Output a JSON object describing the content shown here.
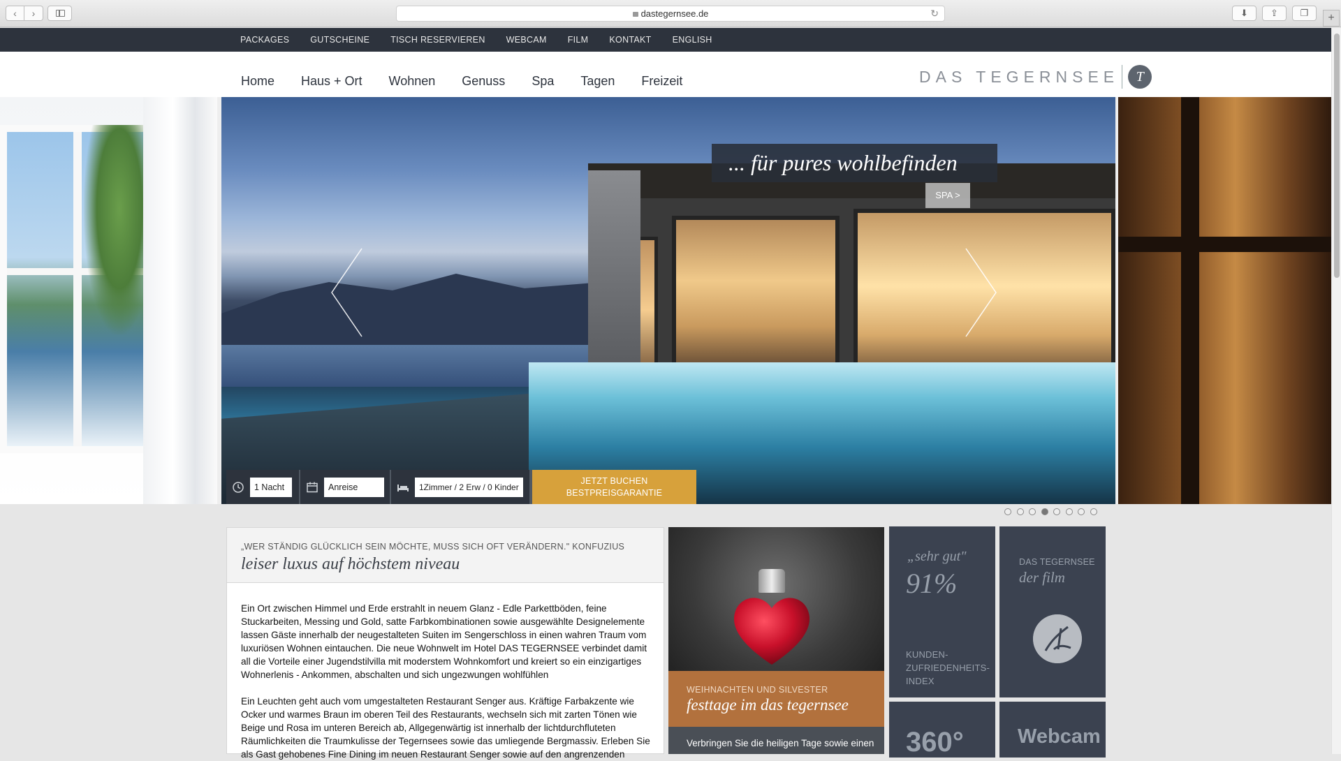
{
  "browser": {
    "url": "dastegernsee.de",
    "back_icon": "chevron-left-icon",
    "forward_icon": "chevron-right-icon"
  },
  "topbar": {
    "links": [
      "PACKAGES",
      "GUTSCHEINE",
      "TISCH RESERVIEREN",
      "WEBCAM",
      "FILM",
      "KONTAKT",
      "ENGLISH"
    ]
  },
  "mainnav": {
    "items": [
      "Home",
      "Haus + Ort",
      "Wohnen",
      "Genuss",
      "Spa",
      "Tagen",
      "Freizeit"
    ]
  },
  "logo": {
    "text": "DAS TEGERNSEE",
    "mark": "T"
  },
  "hero": {
    "tagline": "... für pures wohlbefinden",
    "button": "SPA >",
    "slides_total": 8,
    "active_slide": 4
  },
  "booking": {
    "nights": "1 Nacht",
    "arrival": "Anreise",
    "rooms": "1Zimmer / 2 Erw / 0 Kinder",
    "cta_line1": "JETZT BUCHEN",
    "cta_line2": "BESTPREISGARANTIE"
  },
  "intro": {
    "quote": "„WER STÄNDIG GLÜCKLICH SEIN  MÖCHTE, MUSS SICH  OFT VERÄNDERN.\"   KONFUZIUS",
    "headline": "leiser luxus auf höchstem niveau",
    "paragraph1": "Ein Ort zwischen Himmel und Erde erstrahlt in neuem Glanz - Edle Parkettböden, feine Stuckarbeiten, Messing und Gold, satte Farbkombinationen sowie ausgewählte Designelemente lassen Gäste innerhalb der neugestalteten Suiten im Sengerschloss in einen wahren Traum vom luxuriösen Wohnen eintauchen. Die neue Wohnwelt im Hotel DAS TEGERNSEE verbindet damit all die Vorteile einer Jugendstilvilla mit moderstem Wohnkomfort und kreiert so ein einzigartiges Wohnerlenis - Ankommen, abschalten und sich ungezwungen wohlfühlen",
    "paragraph2": "Ein Leuchten geht auch vom umgestalteten Restaurant Senger aus. Kräftige Farbakzente wie Ocker und warmes Braun im oberen Teil des Restaurants, wechseln sich mit zarten Tönen wie Beige und Rosa im unteren Bereich ab, Allgegenwärtig ist innerhalb der lichtdurchfluteten Räumlichkeiten die Traumkulisse der Tegernsees sowie das umliegende Bergmassiv. Erleben Sie als Gast gehobenes Fine Dining im neuen Restaurant Senger sowie auf den angrenzenden"
  },
  "xmas": {
    "kicker": "WEIHNACHTEN UND SILVESTER",
    "title": "festtage im das tegernsee",
    "teaser": "Verbringen Sie die heiligen Tage sowie einen"
  },
  "tiles": {
    "rating_quote": "„sehr gut\"",
    "rating_value": "91%",
    "rating_label": "KUNDEN-\nZUFRIEDENHEITS-\nINDEX",
    "film_kicker": "DAS TEGERNSEE",
    "film_title": "der film",
    "t360": "360°",
    "webcam": "Webcam"
  },
  "colors": {
    "dark": "#2d333d",
    "gold": "#d7a13b",
    "copper": "#b2713d",
    "tile": "#3b4250"
  }
}
